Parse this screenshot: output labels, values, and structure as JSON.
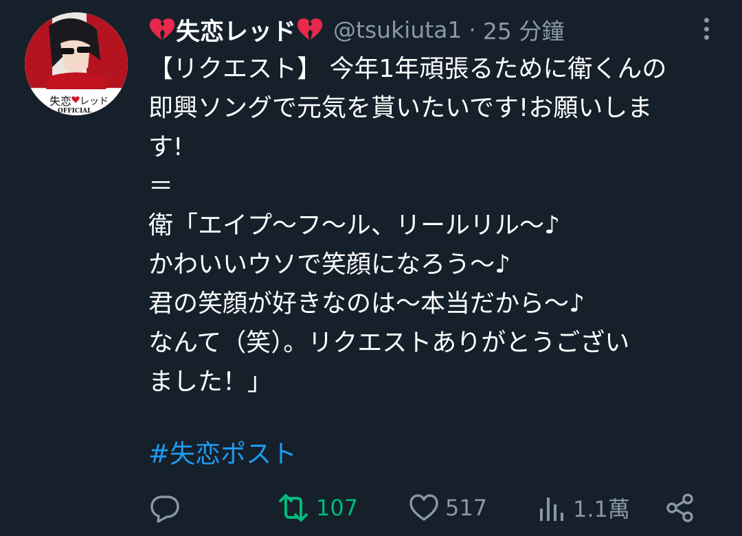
{
  "tweet": {
    "display_name": "失恋レッド",
    "handle": "@tsukiuta1",
    "separator": "·",
    "time": "25 分鐘",
    "body_lines": [
      "【リクエスト】 今年1年頑張るために衛くんの",
      "即興ソングで元気を貰いたいです!お願いしま",
      "す!",
      "＝",
      "衛「エイプ〜フ〜ル、リールリル〜♪",
      "かわいいウソで笑顔になろう〜♪",
      "君の笑顔が好きなのは〜本当だから〜♪",
      "なんて（笑）。リクエストありがとうござい",
      "ました！」"
    ],
    "hashtag": "#失恋ポスト"
  },
  "avatar": {
    "text_top": "失恋",
    "text_bottom": "レッド",
    "text_official": "OFFICIAL"
  },
  "actions": {
    "reply_count": "",
    "retweet_count": "107",
    "like_count": "517",
    "views_count": "1.1萬"
  },
  "colors": {
    "background": "#15202b",
    "muted": "#8b98a5",
    "retweet_active": "#00ba7c",
    "link": "#1d9bf0",
    "heart": "#e8294b"
  },
  "icons": [
    "broken-heart-icon",
    "more-icon",
    "reply-icon",
    "retweet-icon",
    "like-icon",
    "views-icon",
    "share-icon"
  ]
}
